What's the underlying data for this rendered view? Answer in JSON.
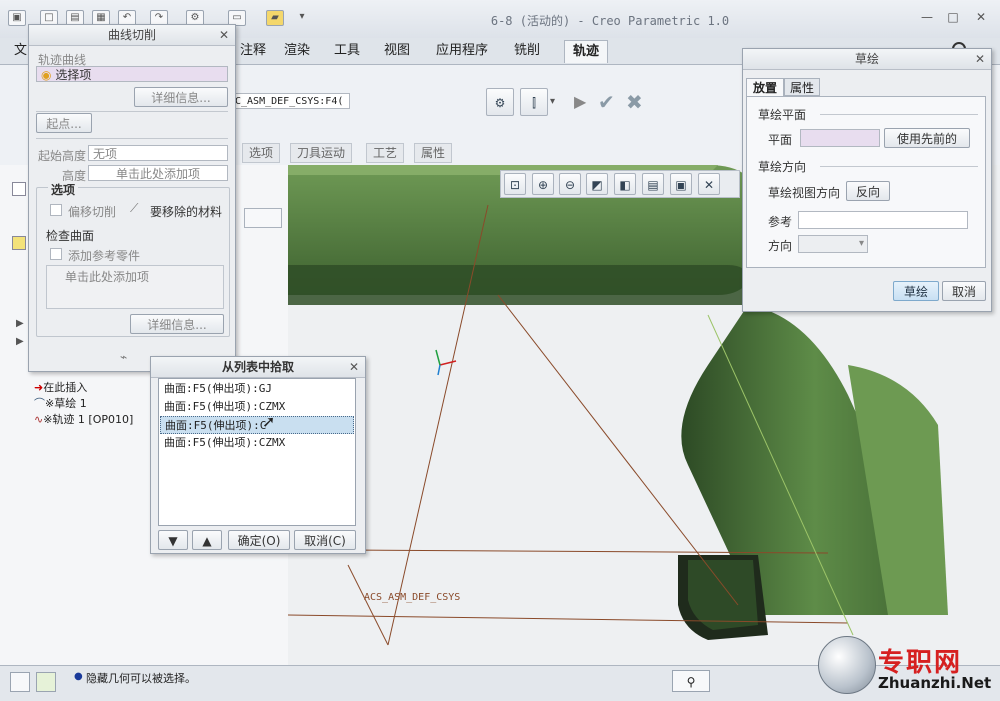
{
  "window": {
    "title": "6-8 (活动的) - Creo Parametric 1.0",
    "controls": [
      "—",
      "□",
      "✕"
    ]
  },
  "menu_tabs": [
    {
      "label": "文"
    },
    {
      "label": "注释"
    },
    {
      "label": "渲染"
    },
    {
      "label": "工具"
    },
    {
      "label": "视图"
    },
    {
      "label": "应用程序"
    },
    {
      "label": "铣削"
    },
    {
      "label": "轨迹"
    }
  ],
  "ribbon": {
    "csys_text": "C_ASM_DEF_CSYS:F4(",
    "subtabs": [
      "选项",
      "刀具运动",
      "工艺",
      "属性"
    ]
  },
  "curve_cut_panel": {
    "title": "曲线切削",
    "trajectory_label": "轨迹曲线",
    "selection_value": "选择项",
    "details_button": "详细信息...",
    "start_point_button": "起点...",
    "start_height_label": "起始高度",
    "start_height_value": "无项",
    "height_label": "高度",
    "height_placeholder": "单击此处添加项",
    "options_group": "选项",
    "offset_cut_label": "偏移切削",
    "material_remove_label": "要移除的材料",
    "check_surface_label": "检查曲面",
    "add_ref_part_label": "添加参考零件",
    "add_item_placeholder": "单击此处添加项",
    "details_button_2": "详细信息..."
  },
  "pick_from_list": {
    "title": "从列表中拾取",
    "items": [
      "曲面:F5(伸出项):GJ",
      "曲面:F5(伸出项):CZMX",
      "曲面:F5(伸出项):C",
      "曲面:F5(伸出项):CZMX"
    ],
    "selected_index": 2,
    "ok_button": "确定(O)",
    "cancel_button": "取消(C)"
  },
  "sketch_panel": {
    "title": "草绘",
    "tabs": [
      "放置",
      "属性"
    ],
    "sketch_plane_label": "草绘平面",
    "plane_label": "平面",
    "use_previous_button": "使用先前的",
    "sketch_orientation_label": "草绘方向",
    "view_direction_label": "草绘视图方向",
    "flip_button": "反向",
    "reference_label": "参考",
    "orientation_label": "方向",
    "sketch_button": "草绘",
    "cancel_button": "取消"
  },
  "model_tree": {
    "items": [
      {
        "label": "在此插入"
      },
      {
        "label": "※草绘 1"
      },
      {
        "label": "※轨迹 1 [OP010]"
      }
    ]
  },
  "viewport": {
    "csys_label": "ACS_ASM_DEF_CSYS"
  },
  "status": {
    "message": "隐藏几何可以被选择。"
  },
  "watermark": {
    "brand_cn": "专职网",
    "brand_url": "Zhuanzhi.Net"
  },
  "colors": {
    "model_green": "#4f7a3b",
    "model_dark": "#2c4a24",
    "selection_blue": "#c9dff0",
    "watermark_red": "#d62020"
  }
}
